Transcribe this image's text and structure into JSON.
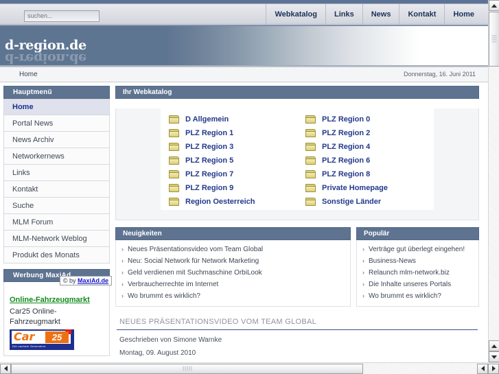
{
  "topbar": {
    "search": {
      "placeholder": "suchen...",
      "value": ""
    },
    "nav": [
      {
        "label": "Webkatalog"
      },
      {
        "label": "Links"
      },
      {
        "label": "News"
      },
      {
        "label": "Kontakt"
      },
      {
        "label": "Home"
      }
    ]
  },
  "banner": {
    "logo": "d-region.de",
    "logo_reflection": "d-region.de"
  },
  "crumbbar": {
    "breadcrumb": "Home",
    "date": "Donnerstag, 16. Juni 2011"
  },
  "sidebar": {
    "main_menu": {
      "title": "Hauptmenü",
      "items": [
        {
          "label": "Home",
          "active": true
        },
        {
          "label": "Portal News",
          "active": false
        },
        {
          "label": "News Archiv",
          "active": false
        },
        {
          "label": "Networkernews",
          "active": false
        },
        {
          "label": "Links",
          "active": false
        },
        {
          "label": "Kontakt",
          "active": false
        },
        {
          "label": "Suche",
          "active": false
        },
        {
          "label": "MLM Forum",
          "active": false
        },
        {
          "label": "MLM-Network Weblog",
          "active": false
        },
        {
          "label": "Produkt des Monats",
          "active": false
        }
      ]
    },
    "ad": {
      "title": "Werbung MaxiAd",
      "copy_prefix": "© by",
      "copy_link": "MaxiAd.de",
      "headline": "Online-Fahrzeugmarkt",
      "text": "Car25 Online-Fahrzeugmarkt",
      "logo_car": "Car",
      "logo_num": "25",
      "logo_tag": "Die nachste Generation"
    }
  },
  "catalog": {
    "title": "Ihr Webkatalog",
    "items": [
      {
        "label": "D Allgemein"
      },
      {
        "label": "PLZ Region 0"
      },
      {
        "label": "PLZ Region 1"
      },
      {
        "label": "PLZ Region 2"
      },
      {
        "label": "PLZ Region 3"
      },
      {
        "label": "PLZ Region 4"
      },
      {
        "label": "PLZ Region 5"
      },
      {
        "label": "PLZ Region 6"
      },
      {
        "label": "PLZ Region 7"
      },
      {
        "label": "PLZ Region 8"
      },
      {
        "label": "PLZ Region 9"
      },
      {
        "label": "Private Homepage"
      },
      {
        "label": "Region Oesterreich"
      },
      {
        "label": "Sonstige Länder"
      }
    ]
  },
  "neuigkeiten": {
    "title": "Neuigkeiten",
    "items": [
      {
        "label": "Neues Präsentationsvideo vom Team Global"
      },
      {
        "label": "Neu: Social Network für Network Marketing"
      },
      {
        "label": "Geld verdienen mit Suchmaschine OrbiLook"
      },
      {
        "label": "Verbraucherrechte im Internet"
      },
      {
        "label": "Wo brummt es wirklich?"
      }
    ]
  },
  "popular": {
    "title": "Populär",
    "items": [
      {
        "label": "Verträge gut überlegt eingehen!"
      },
      {
        "label": "Business-News"
      },
      {
        "label": "Relaunch mlm-network.biz"
      },
      {
        "label": "Die Inhalte unseres Portals"
      },
      {
        "label": "Wo brummt es wirklich?"
      }
    ]
  },
  "article": {
    "title": "NEUES PRÄSENTATIONSVIDEO VOM TEAM GLOBAL",
    "author": "Geschrieben von Simone Warnke",
    "date": "Montag, 09. August 2010"
  },
  "colors": {
    "header_blue": "#5e7390",
    "link_blue": "#23398a",
    "accent_green": "#118b1c",
    "banner_blue": "#5e7592"
  }
}
